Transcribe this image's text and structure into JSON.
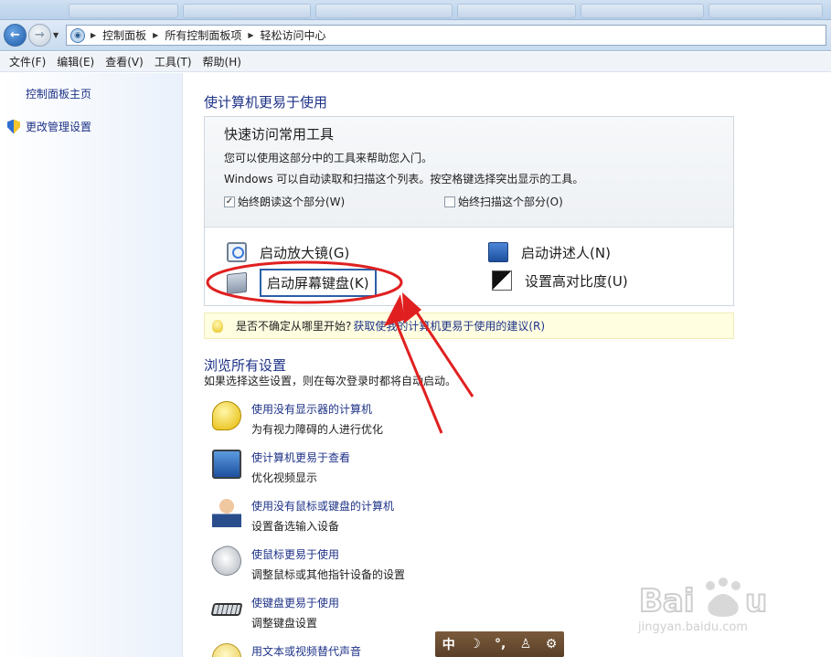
{
  "breadcrumb": {
    "items": [
      "控制面板",
      "所有控制面板项",
      "轻松访问中心"
    ]
  },
  "menu": {
    "items": [
      "文件(F)",
      "编辑(E)",
      "查看(V)",
      "工具(T)",
      "帮助(H)"
    ]
  },
  "left_pane": {
    "home": "控制面板主页",
    "admin": "更改管理设置"
  },
  "main": {
    "title": "使计算机更易于使用",
    "quick": {
      "heading": "快速访问常用工具",
      "desc1": "您可以使用这部分中的工具来帮助您入门。",
      "desc2": "Windows 可以自动读取和扫描这个列表。按空格键选择突出显示的工具。",
      "check_read": {
        "label": "始终朗读这个部分(W)",
        "checked": true
      },
      "check_scan": {
        "label": "始终扫描这个部分(O)",
        "checked": false
      },
      "tools": {
        "magnifier": "启动放大镜(G)",
        "narrator": "启动讲述人(N)",
        "osk": "启动屏幕键盘(K)",
        "contrast": "设置高对比度(U)"
      }
    },
    "hint": {
      "text": "是否不确定从哪里开始?",
      "link": "获取使我的计算机更易于使用的建议(R)"
    },
    "browse": {
      "title": "浏览所有设置",
      "desc": "如果选择这些设置，则在每次登录时都将自动启动。",
      "items": [
        {
          "link": "使用没有显示器的计算机",
          "desc": "为有视力障碍的人进行优化"
        },
        {
          "link": "使计算机更易于查看",
          "desc": "优化视频显示"
        },
        {
          "link": "使用没有鼠标或键盘的计算机",
          "desc": "设置备选输入设备"
        },
        {
          "link": "使鼠标更易于使用",
          "desc": "调整鼠标或其他指针设备的设置"
        },
        {
          "link": "使键盘更易于使用",
          "desc": "调整键盘设置"
        },
        {
          "link": "用文本或视频替代声音",
          "desc": ""
        }
      ]
    }
  },
  "ime": {
    "mode": "中",
    "icons": [
      "moon-icon",
      "punctuation-icon",
      "user-icon",
      "gear-icon"
    ]
  },
  "watermark": {
    "brand": "Baidu经验",
    "url": "jingyan.baidu.com"
  },
  "colors": {
    "link": "#1e3287",
    "annotation": "#e02020",
    "hint_bg": "#fffee1"
  }
}
